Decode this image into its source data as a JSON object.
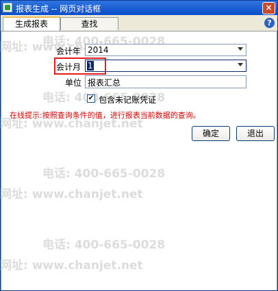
{
  "window": {
    "title": "报表生成 -- 网页对话框",
    "close_glyph": "×"
  },
  "tabs": [
    {
      "label": "生成报表",
      "active": true
    },
    {
      "label": "查找",
      "active": false
    }
  ],
  "help_glyph": "?",
  "form": {
    "year_label": "会计年",
    "year_value": "2014",
    "month_label": "会计月",
    "month_value": "1",
    "unit_label": "单位",
    "unit_value": "报表汇总",
    "checkbox_label": "包含未记账凭证",
    "checkbox_checked": true,
    "checkbox_glyph": "✔"
  },
  "hint": "在线提示:按照查询条件的值，进行报表当前数据的查询。",
  "buttons": {
    "ok": "确定",
    "exit": "退出"
  },
  "watermarks": [
    "电话: 400-665-0028",
    "网址: www.chanjet.net"
  ],
  "colors": {
    "titlebar": "#0b4dc7",
    "hint": "#cc0000",
    "highlight": "#e21b1b"
  }
}
